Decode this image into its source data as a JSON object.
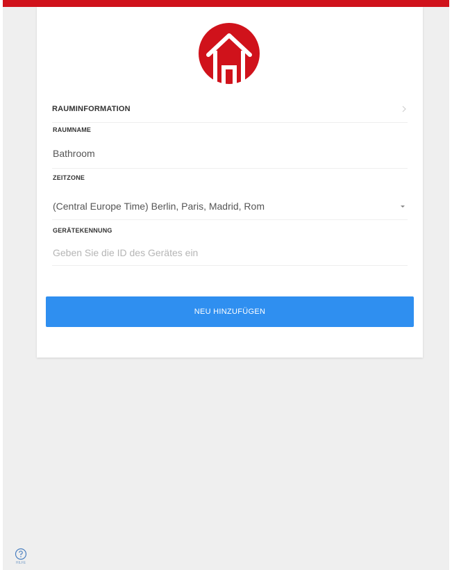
{
  "colors": {
    "brand_red": "#d0121b",
    "button_blue": "#2f8ff0",
    "background": "#efefef"
  },
  "logo": {
    "icon": "house-icon"
  },
  "section": {
    "title": "RAUMINFORMATION"
  },
  "fields": {
    "room_name": {
      "label": "RAUMNAME",
      "value": "Bathroom"
    },
    "timezone": {
      "label": "ZEITZONE",
      "value": "(Central Europe Time) Berlin, Paris, Madrid, Rom"
    },
    "device_id": {
      "label": "GERÄTEKENNUNG",
      "placeholder": "Geben Sie die ID des Gerätes ein"
    }
  },
  "button": {
    "label": "NEU HINZUFÜGEN"
  },
  "help": {
    "label": "HILFE"
  }
}
